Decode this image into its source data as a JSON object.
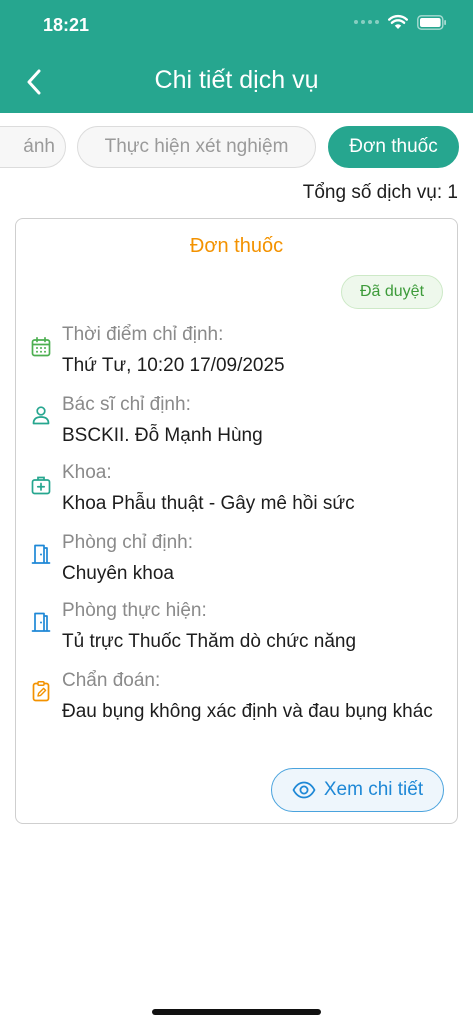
{
  "status_bar": {
    "time": "18:21"
  },
  "header": {
    "title": "Chi tiết dịch vụ"
  },
  "tabs": [
    {
      "label": "ánh"
    },
    {
      "label": "Thực hiện xét nghiệm"
    },
    {
      "label": "Đơn thuốc",
      "active": true
    }
  ],
  "total": "Tổng số dịch vụ: 1",
  "card": {
    "title": "Đơn thuốc",
    "status": "Đã duyệt",
    "fields": [
      {
        "icon": "calendar-icon",
        "label": "Thời điểm chỉ định:",
        "value": "Thứ Tư, 10:20 17/09/2025"
      },
      {
        "icon": "person-icon",
        "label": "Bác sĩ chỉ định:",
        "value": "BSCKII. Đỗ Mạnh Hùng"
      },
      {
        "icon": "medical-kit-icon",
        "label": "Khoa:",
        "value": "Khoa Phẫu thuật - Gây mê hồi sức"
      },
      {
        "icon": "door-icon",
        "label": "Phòng chỉ định:",
        "value": "Chuyên khoa"
      },
      {
        "icon": "door-icon",
        "label": "Phòng thực hiện:",
        "value": "Tủ trực Thuốc Thăm dò chức năng"
      },
      {
        "icon": "clipboard-edit-icon",
        "label": "Chẩn đoán:",
        "value": "Đau bụng không xác định và đau bụng khác"
      }
    ],
    "detail_button": "Xem chi tiết"
  },
  "colors": {
    "primary": "#26a68f",
    "accent_orange": "#f39200",
    "badge_green": "#3d9b3a",
    "link_blue": "#1e88d6"
  }
}
